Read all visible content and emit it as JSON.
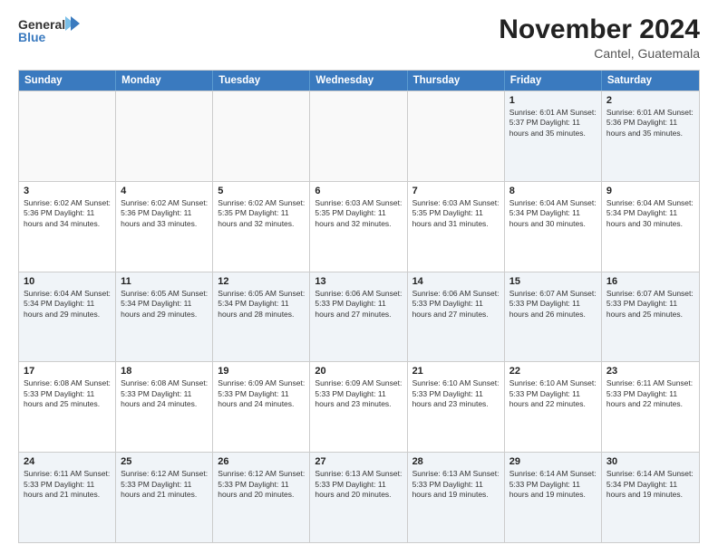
{
  "header": {
    "logo_line1": "General",
    "logo_line2": "Blue",
    "month_year": "November 2024",
    "location": "Cantel, Guatemala"
  },
  "weekdays": [
    "Sunday",
    "Monday",
    "Tuesday",
    "Wednesday",
    "Thursday",
    "Friday",
    "Saturday"
  ],
  "weeks": [
    [
      {
        "day": "",
        "info": ""
      },
      {
        "day": "",
        "info": ""
      },
      {
        "day": "",
        "info": ""
      },
      {
        "day": "",
        "info": ""
      },
      {
        "day": "",
        "info": ""
      },
      {
        "day": "1",
        "info": "Sunrise: 6:01 AM\nSunset: 5:37 PM\nDaylight: 11 hours\nand 35 minutes."
      },
      {
        "day": "2",
        "info": "Sunrise: 6:01 AM\nSunset: 5:36 PM\nDaylight: 11 hours\nand 35 minutes."
      }
    ],
    [
      {
        "day": "3",
        "info": "Sunrise: 6:02 AM\nSunset: 5:36 PM\nDaylight: 11 hours\nand 34 minutes."
      },
      {
        "day": "4",
        "info": "Sunrise: 6:02 AM\nSunset: 5:36 PM\nDaylight: 11 hours\nand 33 minutes."
      },
      {
        "day": "5",
        "info": "Sunrise: 6:02 AM\nSunset: 5:35 PM\nDaylight: 11 hours\nand 32 minutes."
      },
      {
        "day": "6",
        "info": "Sunrise: 6:03 AM\nSunset: 5:35 PM\nDaylight: 11 hours\nand 32 minutes."
      },
      {
        "day": "7",
        "info": "Sunrise: 6:03 AM\nSunset: 5:35 PM\nDaylight: 11 hours\nand 31 minutes."
      },
      {
        "day": "8",
        "info": "Sunrise: 6:04 AM\nSunset: 5:34 PM\nDaylight: 11 hours\nand 30 minutes."
      },
      {
        "day": "9",
        "info": "Sunrise: 6:04 AM\nSunset: 5:34 PM\nDaylight: 11 hours\nand 30 minutes."
      }
    ],
    [
      {
        "day": "10",
        "info": "Sunrise: 6:04 AM\nSunset: 5:34 PM\nDaylight: 11 hours\nand 29 minutes."
      },
      {
        "day": "11",
        "info": "Sunrise: 6:05 AM\nSunset: 5:34 PM\nDaylight: 11 hours\nand 29 minutes."
      },
      {
        "day": "12",
        "info": "Sunrise: 6:05 AM\nSunset: 5:34 PM\nDaylight: 11 hours\nand 28 minutes."
      },
      {
        "day": "13",
        "info": "Sunrise: 6:06 AM\nSunset: 5:33 PM\nDaylight: 11 hours\nand 27 minutes."
      },
      {
        "day": "14",
        "info": "Sunrise: 6:06 AM\nSunset: 5:33 PM\nDaylight: 11 hours\nand 27 minutes."
      },
      {
        "day": "15",
        "info": "Sunrise: 6:07 AM\nSunset: 5:33 PM\nDaylight: 11 hours\nand 26 minutes."
      },
      {
        "day": "16",
        "info": "Sunrise: 6:07 AM\nSunset: 5:33 PM\nDaylight: 11 hours\nand 25 minutes."
      }
    ],
    [
      {
        "day": "17",
        "info": "Sunrise: 6:08 AM\nSunset: 5:33 PM\nDaylight: 11 hours\nand 25 minutes."
      },
      {
        "day": "18",
        "info": "Sunrise: 6:08 AM\nSunset: 5:33 PM\nDaylight: 11 hours\nand 24 minutes."
      },
      {
        "day": "19",
        "info": "Sunrise: 6:09 AM\nSunset: 5:33 PM\nDaylight: 11 hours\nand 24 minutes."
      },
      {
        "day": "20",
        "info": "Sunrise: 6:09 AM\nSunset: 5:33 PM\nDaylight: 11 hours\nand 23 minutes."
      },
      {
        "day": "21",
        "info": "Sunrise: 6:10 AM\nSunset: 5:33 PM\nDaylight: 11 hours\nand 23 minutes."
      },
      {
        "day": "22",
        "info": "Sunrise: 6:10 AM\nSunset: 5:33 PM\nDaylight: 11 hours\nand 22 minutes."
      },
      {
        "day": "23",
        "info": "Sunrise: 6:11 AM\nSunset: 5:33 PM\nDaylight: 11 hours\nand 22 minutes."
      }
    ],
    [
      {
        "day": "24",
        "info": "Sunrise: 6:11 AM\nSunset: 5:33 PM\nDaylight: 11 hours\nand 21 minutes."
      },
      {
        "day": "25",
        "info": "Sunrise: 6:12 AM\nSunset: 5:33 PM\nDaylight: 11 hours\nand 21 minutes."
      },
      {
        "day": "26",
        "info": "Sunrise: 6:12 AM\nSunset: 5:33 PM\nDaylight: 11 hours\nand 20 minutes."
      },
      {
        "day": "27",
        "info": "Sunrise: 6:13 AM\nSunset: 5:33 PM\nDaylight: 11 hours\nand 20 minutes."
      },
      {
        "day": "28",
        "info": "Sunrise: 6:13 AM\nSunset: 5:33 PM\nDaylight: 11 hours\nand 19 minutes."
      },
      {
        "day": "29",
        "info": "Sunrise: 6:14 AM\nSunset: 5:33 PM\nDaylight: 11 hours\nand 19 minutes."
      },
      {
        "day": "30",
        "info": "Sunrise: 6:14 AM\nSunset: 5:34 PM\nDaylight: 11 hours\nand 19 minutes."
      }
    ]
  ]
}
